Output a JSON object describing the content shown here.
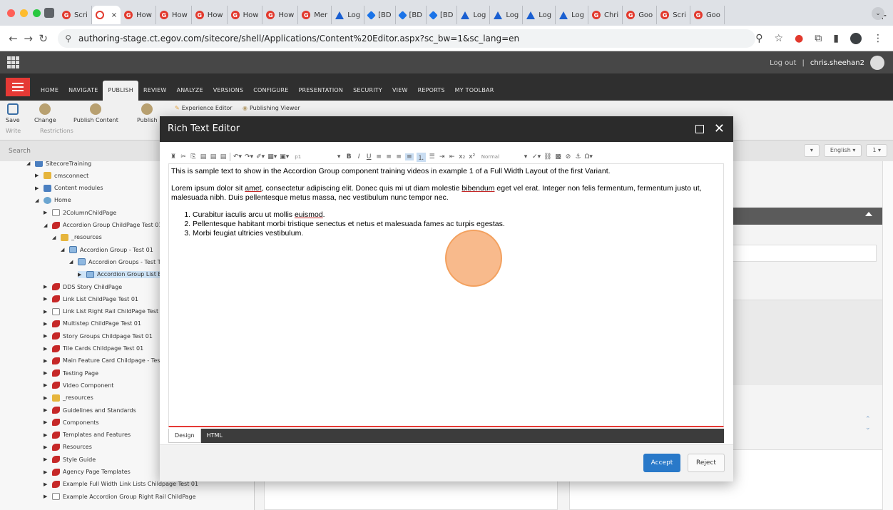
{
  "browser": {
    "tabs": [
      {
        "label": "Scri",
        "icon": "red-logo"
      },
      {
        "label": "",
        "icon": "loading",
        "active": true
      },
      {
        "label": "How",
        "icon": "red-logo"
      },
      {
        "label": "How",
        "icon": "red-logo"
      },
      {
        "label": "How",
        "icon": "red-logo"
      },
      {
        "label": "How",
        "icon": "red-logo"
      },
      {
        "label": "How",
        "icon": "red-logo"
      },
      {
        "label": "Mer",
        "icon": "red-logo"
      },
      {
        "label": "Log",
        "icon": "triangle"
      },
      {
        "label": "[BD",
        "icon": "diamond"
      },
      {
        "label": "[BD",
        "icon": "diamond"
      },
      {
        "label": "[BD",
        "icon": "diamond"
      },
      {
        "label": "Log",
        "icon": "triangle"
      },
      {
        "label": "Log",
        "icon": "triangle"
      },
      {
        "label": "Log",
        "icon": "triangle"
      },
      {
        "label": "Log",
        "icon": "triangle"
      },
      {
        "label": "Chri",
        "icon": "red-logo"
      },
      {
        "label": "Goo",
        "icon": "red-logo"
      },
      {
        "label": "Scri",
        "icon": "red-logo"
      },
      {
        "label": "Goo",
        "icon": "red-logo"
      }
    ],
    "url": "authoring-stage.ct.egov.com/sitecore/shell/Applications/Content%20Editor.aspx?sc_bw=1&sc_lang=en"
  },
  "header": {
    "logout": "Log out",
    "separator": "|",
    "username": "chris.sheehan2"
  },
  "ribbon": {
    "tabs": [
      "HOME",
      "NAVIGATE",
      "PUBLISH",
      "REVIEW",
      "ANALYZE",
      "VERSIONS",
      "CONFIGURE",
      "PRESENTATION",
      "SECURITY",
      "VIEW",
      "REPORTS",
      "MY TOOLBAR"
    ],
    "active_tab": "PUBLISH",
    "save": "Save",
    "change": "Change",
    "publish_content": "Publish Content",
    "publish": "Publish",
    "experience_editor": "Experience Editor",
    "publishing_viewer": "Publishing Viewer",
    "group_write": "Write",
    "group_restrictions": "Restrictions"
  },
  "search": {
    "placeholder": "Search"
  },
  "tree": [
    {
      "label": "SitecoreTraining",
      "indent": 0,
      "arrow": "open",
      "icon": "blue"
    },
    {
      "label": "cmsconnect",
      "indent": 1,
      "arrow": "closed",
      "icon": "folder"
    },
    {
      "label": "Content modules",
      "indent": 1,
      "arrow": "closed",
      "icon": "blue"
    },
    {
      "label": "Home",
      "indent": 1,
      "arrow": "open",
      "icon": "home"
    },
    {
      "label": "2ColumnChildPage",
      "indent": 2,
      "arrow": "closed",
      "icon": "page"
    },
    {
      "label": "Accordion Group ChildPage Test 01",
      "indent": 2,
      "arrow": "open",
      "icon": "red"
    },
    {
      "label": "_resources",
      "indent": 3,
      "arrow": "open",
      "icon": "folder"
    },
    {
      "label": "Accordion Group - Test 01",
      "indent": 4,
      "arrow": "open",
      "icon": "list"
    },
    {
      "label": "Accordion Groups - Test Title",
      "indent": 5,
      "arrow": "open",
      "icon": "list"
    },
    {
      "label": "Accordion Group List Exam",
      "indent": 6,
      "arrow": "closed",
      "icon": "list",
      "selected": true
    },
    {
      "label": "DDS Story ChildPage",
      "indent": 2,
      "arrow": "closed",
      "icon": "red"
    },
    {
      "label": "Link List ChildPage Test 01",
      "indent": 2,
      "arrow": "closed",
      "icon": "red"
    },
    {
      "label": "Link List Right Rail ChildPage Test 01",
      "indent": 2,
      "arrow": "closed",
      "icon": "page"
    },
    {
      "label": "Multistep ChildPage Test 01",
      "indent": 2,
      "arrow": "closed",
      "icon": "red"
    },
    {
      "label": "Story Groups Childpage Test 01",
      "indent": 2,
      "arrow": "closed",
      "icon": "red"
    },
    {
      "label": "Tile Cards Childpage Test 01",
      "indent": 2,
      "arrow": "closed",
      "icon": "red"
    },
    {
      "label": "Main Feature Card Childpage - Test 01",
      "indent": 2,
      "arrow": "closed",
      "icon": "red"
    },
    {
      "label": "Testing Page",
      "indent": 2,
      "arrow": "closed",
      "icon": "red"
    },
    {
      "label": "Video Component",
      "indent": 2,
      "arrow": "closed",
      "icon": "red"
    },
    {
      "label": "_resources",
      "indent": 2,
      "arrow": "closed",
      "icon": "folder"
    },
    {
      "label": "Guidelines and Standards",
      "indent": 2,
      "arrow": "closed",
      "icon": "red"
    },
    {
      "label": "Components",
      "indent": 2,
      "arrow": "closed",
      "icon": "red"
    },
    {
      "label": "Templates and Features",
      "indent": 2,
      "arrow": "closed",
      "icon": "red"
    },
    {
      "label": "Resources",
      "indent": 2,
      "arrow": "closed",
      "icon": "red"
    },
    {
      "label": "Style Guide",
      "indent": 2,
      "arrow": "closed",
      "icon": "red"
    },
    {
      "label": "Agency Page Templates",
      "indent": 2,
      "arrow": "closed",
      "icon": "red"
    },
    {
      "label": "Example Full Width Link Lists Childpage Test 01",
      "indent": 2,
      "arrow": "closed",
      "icon": "red"
    },
    {
      "label": "Example Accordion Group Right Rail ChildPage",
      "indent": 2,
      "arrow": "closed",
      "icon": "page"
    }
  ],
  "editor": {
    "lang_icon_btn": "▾",
    "language": "English ▾",
    "version": "1 ▾"
  },
  "modal": {
    "title": "Rich Text Editor",
    "toolbar_paragraph": "p1",
    "toolbar_style": "Normal",
    "paragraph1": "This is sample text to show in the Accordion Group component training videos in example 1 of a Full Width Layout of the first Variant.",
    "p2_a": "Lorem ipsum dolor sit ",
    "p2_amet": "amet",
    "p2_b": ", consectetur adipiscing elit. Donec quis mi ut diam molestie ",
    "p2_bibendum": "bibendum",
    "p2_c": " eget vel erat. Integer non felis fermentum, fermentum justo ut, malesuada nibh. Duis pellentesque metus massa, nec vestibulum nunc tempor nec.",
    "list": [
      {
        "a": "Curabitur iaculis arcu ut mollis ",
        "u": "euismod",
        "b": "."
      },
      {
        "a": "Pellentesque habitant morbi tristique senectus et netus et malesuada fames ac turpis egestas.",
        "u": "",
        "b": ""
      },
      {
        "a": "Morbi feugiat ultricies vestibulum.",
        "u": "",
        "b": ""
      }
    ],
    "mode_design": "Design",
    "mode_html": "HTML",
    "accept": "Accept",
    "reject": "Reject"
  },
  "colors": {
    "accent_red": "#e53935",
    "accept_blue": "#2979c9",
    "cursor_highlight": "#f7ae78"
  }
}
